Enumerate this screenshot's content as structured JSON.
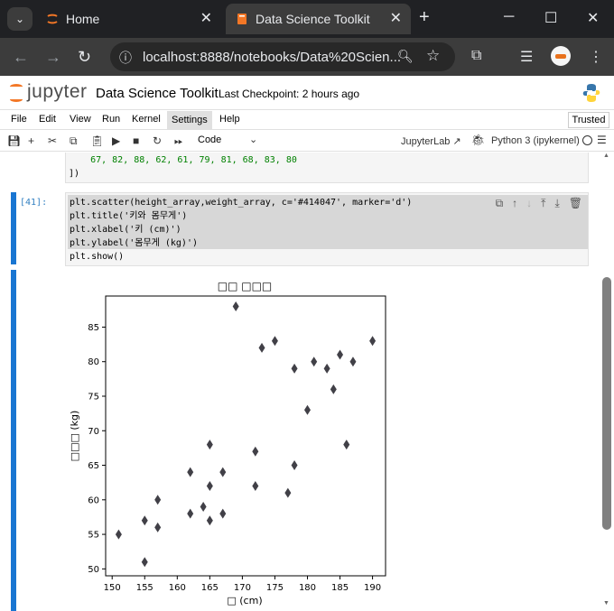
{
  "browser": {
    "tabs": [
      {
        "label": "Home",
        "active": false
      },
      {
        "label": "Data Science Toolkit",
        "active": true
      }
    ],
    "url": "localhost:8888/notebooks/Data%20Scien..."
  },
  "jupyter": {
    "logo_text": "jupyter",
    "title": "Data Science Toolkit",
    "checkpoint": "Last Checkpoint: 2 hours ago",
    "menu": [
      "File",
      "Edit",
      "View",
      "Run",
      "Kernel",
      "Settings",
      "Help"
    ],
    "trusted": "Trusted",
    "cell_type": "Code",
    "jupyterlab_link": "JupyterLab",
    "kernel": "Python 3 (ipykernel)"
  },
  "cells": {
    "prev_output_lines": [
      "    67, 82, 88, 62, 61, 79, 81, 68, 83, 80",
      "])"
    ],
    "current_prompt": "[41]:",
    "current_code": [
      "plt.scatter(height_array,weight_array, c='#414047', marker='d')",
      "plt.title('키와 몸무게')",
      "plt.xlabel('키 (cm)')",
      "plt.ylabel('몸무게 (kg)')",
      "plt.show()"
    ]
  },
  "chart_data": {
    "type": "scatter",
    "title": "□□ □□□",
    "xlabel": "□ (cm)",
    "ylabel": "□□□ (kg)",
    "marker": "diamond",
    "color": "#414047",
    "xlim": [
      149,
      192
    ],
    "ylim": [
      49,
      89.5
    ],
    "xticks": [
      150,
      155,
      160,
      165,
      170,
      175,
      180,
      185,
      190
    ],
    "yticks": [
      50,
      55,
      60,
      65,
      70,
      75,
      80,
      85
    ],
    "points": [
      {
        "x": 151,
        "y": 55
      },
      {
        "x": 155,
        "y": 57
      },
      {
        "x": 155,
        "y": 51
      },
      {
        "x": 157,
        "y": 60
      },
      {
        "x": 157,
        "y": 56
      },
      {
        "x": 162,
        "y": 64
      },
      {
        "x": 162,
        "y": 58
      },
      {
        "x": 164,
        "y": 59
      },
      {
        "x": 165,
        "y": 68
      },
      {
        "x": 165,
        "y": 62
      },
      {
        "x": 165,
        "y": 57
      },
      {
        "x": 167,
        "y": 64
      },
      {
        "x": 167,
        "y": 58
      },
      {
        "x": 169,
        "y": 88
      },
      {
        "x": 172,
        "y": 67
      },
      {
        "x": 172,
        "y": 62
      },
      {
        "x": 173,
        "y": 82
      },
      {
        "x": 175,
        "y": 83
      },
      {
        "x": 177,
        "y": 61
      },
      {
        "x": 178,
        "y": 79
      },
      {
        "x": 178,
        "y": 65
      },
      {
        "x": 180,
        "y": 73
      },
      {
        "x": 181,
        "y": 80
      },
      {
        "x": 183,
        "y": 79
      },
      {
        "x": 184,
        "y": 76
      },
      {
        "x": 185,
        "y": 81
      },
      {
        "x": 186,
        "y": 68
      },
      {
        "x": 187,
        "y": 80
      },
      {
        "x": 190,
        "y": 83
      }
    ]
  }
}
